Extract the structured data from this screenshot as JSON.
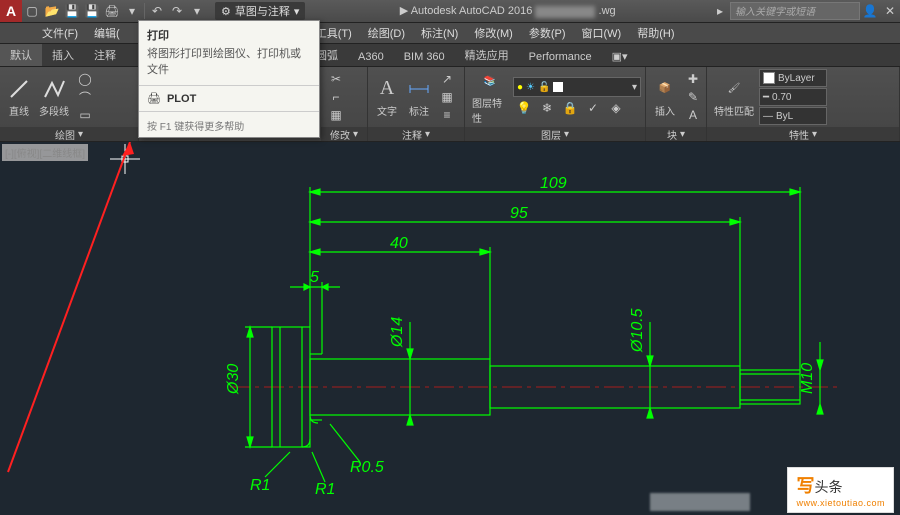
{
  "app": {
    "title_prefix": "Autodesk AutoCAD 2016",
    "doc_suffix": ".wg",
    "workspace": "草图与注释",
    "search_placeholder": "输入关键字或短语"
  },
  "qat_icons": [
    "new",
    "open",
    "save",
    "saveas",
    "print",
    "undo",
    "redo"
  ],
  "menu": [
    "文件(F)",
    "编辑(",
    "工具(T)",
    "绘图(D)",
    "标注(N)",
    "修改(M)",
    "参数(P)",
    "窗口(W)",
    "帮助(H)"
  ],
  "tabs": [
    "默认",
    "插入",
    "注释",
    "圆弧",
    "A360",
    "BIM 360",
    "精选应用",
    "Performance"
  ],
  "tooltip": {
    "title": "打印",
    "desc": "将图形打印到绘图仪、打印机或文件",
    "cmd": "PLOT",
    "f1": "按 F1 键获得更多帮助"
  },
  "ribbon": {
    "draw": {
      "label": "绘图",
      "line": "直线",
      "pline": "多段线"
    },
    "modify": {
      "label": "修改"
    },
    "annot": {
      "label": "注释",
      "text": "文字",
      "dim": "标注"
    },
    "layer": {
      "label": "图层",
      "btn": "图层特性",
      "current": ""
    },
    "block": {
      "label": "块",
      "insert": "插入"
    },
    "prop": {
      "label": "特性",
      "match": "特性匹配",
      "bylayer": "ByLayer",
      "lw": "0.70",
      "lt": "ByL"
    }
  },
  "viewctl": "[-][俯视][二维线框]",
  "drawing": {
    "dims": {
      "d109": "109",
      "d95": "95",
      "d40": "40",
      "d5": "5",
      "d30": "Ø30",
      "d14": "Ø14",
      "d105": "Ø10.5",
      "m10": "M10",
      "r05": "R0.5",
      "r1a": "R1",
      "r1b": "R1"
    }
  },
  "watermark": {
    "brand_pre": "写",
    "brand": "头条",
    "url": "www.xietoutiao.com"
  }
}
